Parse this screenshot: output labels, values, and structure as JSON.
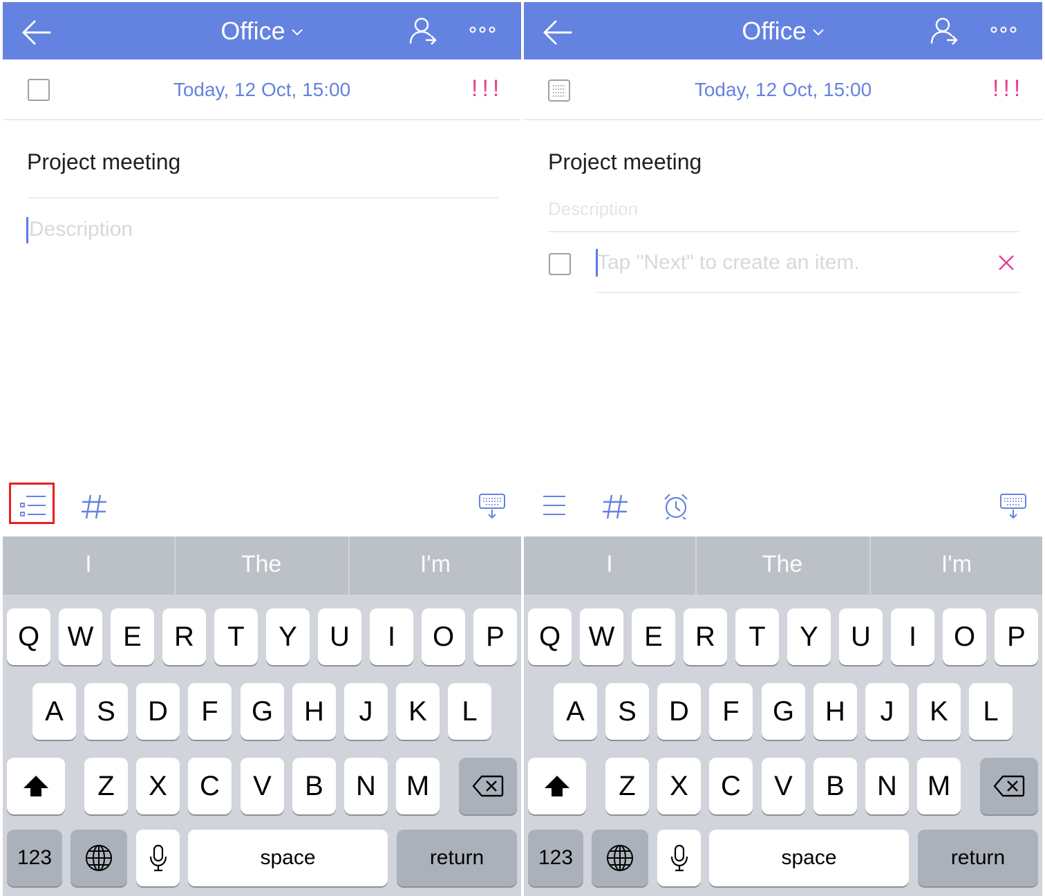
{
  "colors": {
    "header_bg": "#6482e0",
    "accent": "#6482e0",
    "priority": "#e43f8f",
    "remove": "#e43f8f"
  },
  "panels": [
    {
      "header": {
        "title": "Office"
      },
      "date_row": {
        "date": "Today, 12 Oct, 15:00",
        "priority": "!!!"
      },
      "task": {
        "title": "Project meeting",
        "description_placeholder": "Description"
      },
      "toolbar": {
        "icons": [
          "checklist-icon",
          "hashtag-icon",
          "keyboard-dismiss-icon"
        ]
      },
      "keyboard": {
        "suggestions": [
          "I",
          "The",
          "I'm"
        ],
        "row1": [
          "Q",
          "W",
          "E",
          "R",
          "T",
          "Y",
          "U",
          "I",
          "O",
          "P"
        ],
        "row2": [
          "A",
          "S",
          "D",
          "F",
          "G",
          "H",
          "J",
          "K",
          "L"
        ],
        "row3": [
          "Z",
          "X",
          "C",
          "V",
          "B",
          "N",
          "M"
        ],
        "numbers_label": "123",
        "space_label": "space",
        "return_label": "return"
      }
    },
    {
      "header": {
        "title": "Office"
      },
      "date_row": {
        "date": "Today, 12 Oct, 15:00",
        "priority": "!!!"
      },
      "task": {
        "title": "Project meeting",
        "description_placeholder": "Description",
        "item_placeholder": "Tap \"Next\" to create an item."
      },
      "toolbar": {
        "icons": [
          "list-icon",
          "hashtag-icon",
          "alarm-icon",
          "keyboard-dismiss-icon"
        ]
      },
      "keyboard": {
        "suggestions": [
          "I",
          "The",
          "I'm"
        ],
        "row1": [
          "Q",
          "W",
          "E",
          "R",
          "T",
          "Y",
          "U",
          "I",
          "O",
          "P"
        ],
        "row2": [
          "A",
          "S",
          "D",
          "F",
          "G",
          "H",
          "J",
          "K",
          "L"
        ],
        "row3": [
          "Z",
          "X",
          "C",
          "V",
          "B",
          "N",
          "M"
        ],
        "numbers_label": "123",
        "space_label": "space",
        "return_label": "return"
      }
    }
  ]
}
